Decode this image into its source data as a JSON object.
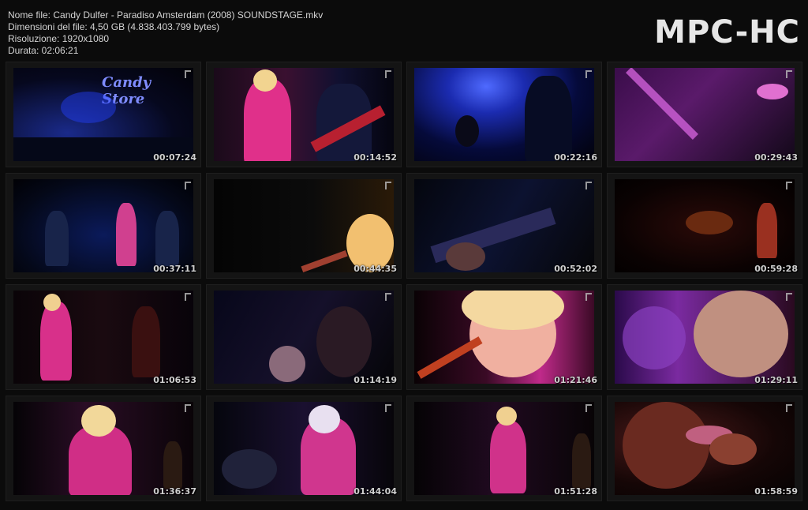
{
  "file_info": {
    "name_line": "Nome file: Candy Dulfer - Paradiso Amsterdam (2008) SOUNDSTAGE.mkv",
    "size_line": "Dimensioni del file: 4,50 GB (4.838.403.799 bytes)",
    "resolution_line": "Risoluzione: 1920x1080",
    "duration_line": "Durata: 02:06:21"
  },
  "logo_text": "MPC-HC",
  "thumbnails": [
    {
      "time": "00:07:24",
      "frame_text": "Candy Store"
    },
    {
      "time": "00:14:52"
    },
    {
      "time": "00:22:16"
    },
    {
      "time": "00:29:43"
    },
    {
      "time": "00:37:11"
    },
    {
      "time": "00:44:35"
    },
    {
      "time": "00:52:02"
    },
    {
      "time": "00:59:28"
    },
    {
      "time": "01:06:53"
    },
    {
      "time": "01:14:19"
    },
    {
      "time": "01:21:46"
    },
    {
      "time": "01:29:11"
    },
    {
      "time": "01:36:37"
    },
    {
      "time": "01:44:04"
    },
    {
      "time": "01:51:28"
    },
    {
      "time": "01:58:59"
    }
  ],
  "colors": {
    "background": "#0b0b0b",
    "text": "#d4d4d4",
    "stage_pink": "#e0308a",
    "stage_blue": "#2a3cd0"
  }
}
